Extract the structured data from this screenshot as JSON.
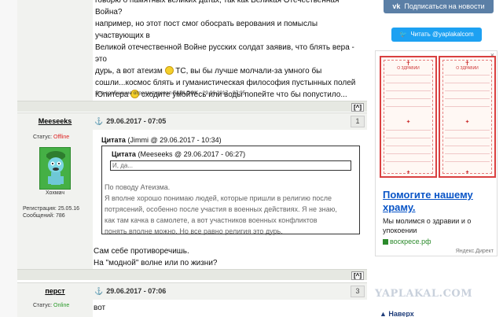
{
  "post0": {
    "text_lines": [
      "говорю о памятных великих датах, так как Великая Отечественная Война?",
      "например, но этот пост смог обосрать верования и помыслы участвующих в",
      "Великой отечественной Войне русских солдат заявив, что блять вера - это",
      "дурь, а вот атеизм",
      " ТС, вы бы лучше молчали-за умного бы",
      "сошли...космос блять и гуманистическая философия пустынных полей",
      "Юпитера",
      " сходите умойтесь или воды попейте что бы попустило..."
    ],
    "edited_prefix": "Это сообщение отредактировал",
    "edited_by": "FABLOOK",
    "edited_date": "- 29.06.2017 - 07:05",
    "top_label": "[^]"
  },
  "post1": {
    "username": "Meeseeks",
    "status_label": "Статус:",
    "status_value": "Offline",
    "title": "Хохмач",
    "reg_label": "Регистрация:",
    "reg_date": "25.05.16",
    "msgs_label": "Сообщений:",
    "msgs_count": "786",
    "anchor_icon": "anchor-icon",
    "datetime": "29.06.2017 - 07:05",
    "number": "1",
    "quote_outer_label": "Цитата",
    "quote_outer_meta": "(Jimmi @ 29.06.2017 - 10:34)",
    "quote_inner_label": "Цитата",
    "quote_inner_meta": "(Meeseeks @ 29.06.2017 - 06:27)",
    "quote_inner_text": "И, да...",
    "quote_outer_lines": [
      "По поводу Атеизма.",
      "Я вполне хорошо понимаю людей, которые пришли в религию после",
      "потрясений, особенно после участия в военных действиях. Я не знаю,",
      "как там качка в самолете, а вот участников военных конфликтов",
      "понять вполне можно. Но все равно религия это дурь."
    ],
    "reply_lines": [
      "Сам себе противоречишь.",
      "На \"модной\" волне или по жизни?"
    ],
    "top_label": "[^]"
  },
  "post2": {
    "username": "перст",
    "status_label": "Статус:",
    "status_value": "Online",
    "datetime": "29.06.2017 - 07:06",
    "number": "3",
    "text": "вот"
  },
  "sidebar": {
    "vk_label": "Подписаться на новости",
    "twitter_label": "Читать @yaplakalcom",
    "ad": {
      "card_label": "О ЗДРАВИИ",
      "title_lines": [
        "Помогите нашему",
        "храму."
      ],
      "desc_lines": [
        "Мы молимся о здравии и о",
        "упокоении"
      ],
      "link": "воскресе.рф",
      "source": "Яндекс.Директ",
      "close": "×"
    },
    "logo": "YAPLAKAL.COM",
    "nav_label": "▲ Наверх"
  },
  "colors": {
    "offline": "#dd2222",
    "online": "#2a9a2a",
    "link": "#0a55c7",
    "vk": "#5b7fa6",
    "twitter": "#1da1f2"
  }
}
